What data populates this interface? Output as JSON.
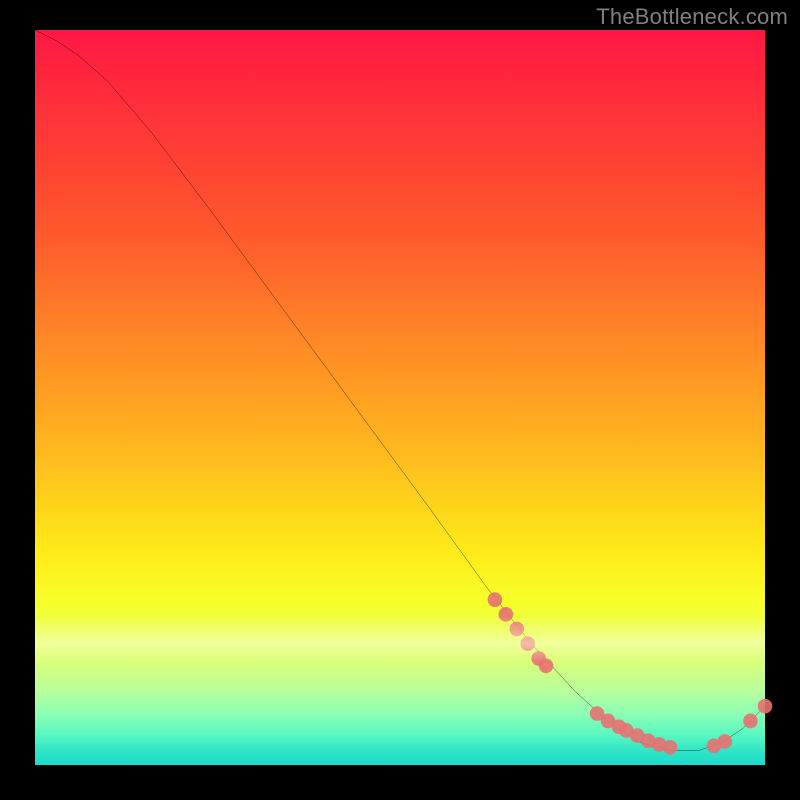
{
  "attribution": "TheBottleneck.com",
  "chart_data": {
    "type": "line",
    "title": "",
    "xlabel": "",
    "ylabel": "",
    "xlim": [
      0,
      100
    ],
    "ylim": [
      0,
      100
    ],
    "curve": [
      {
        "x": 0,
        "y": 100
      },
      {
        "x": 3,
        "y": 98.5
      },
      {
        "x": 6,
        "y": 96.5
      },
      {
        "x": 10,
        "y": 93
      },
      {
        "x": 16,
        "y": 86
      },
      {
        "x": 24,
        "y": 75.5
      },
      {
        "x": 34,
        "y": 62
      },
      {
        "x": 44,
        "y": 48.5
      },
      {
        "x": 54,
        "y": 35
      },
      {
        "x": 62,
        "y": 24
      },
      {
        "x": 68,
        "y": 16.5
      },
      {
        "x": 74,
        "y": 10
      },
      {
        "x": 79,
        "y": 5.5
      },
      {
        "x": 83,
        "y": 3
      },
      {
        "x": 87,
        "y": 2
      },
      {
        "x": 91,
        "y": 2
      },
      {
        "x": 94,
        "y": 3
      },
      {
        "x": 97,
        "y": 5
      },
      {
        "x": 100,
        "y": 8
      }
    ],
    "marker_clusters": [
      {
        "x": 63,
        "y": 22.5
      },
      {
        "x": 64.5,
        "y": 20.5
      },
      {
        "x": 66,
        "y": 18.5
      },
      {
        "x": 67.5,
        "y": 16.5
      },
      {
        "x": 69,
        "y": 14.5
      },
      {
        "x": 70,
        "y": 13.5
      },
      {
        "x": 77,
        "y": 7
      },
      {
        "x": 78.5,
        "y": 6
      },
      {
        "x": 80,
        "y": 5.2
      },
      {
        "x": 81,
        "y": 4.7
      },
      {
        "x": 82.5,
        "y": 4
      },
      {
        "x": 84,
        "y": 3.3
      },
      {
        "x": 85.5,
        "y": 2.8
      },
      {
        "x": 87,
        "y": 2.4
      },
      {
        "x": 93,
        "y": 2.6
      },
      {
        "x": 94.5,
        "y": 3.2
      },
      {
        "x": 98,
        "y": 6
      },
      {
        "x": 100,
        "y": 8
      }
    ],
    "marker_color": "#e87171",
    "line_color": "#000000"
  }
}
